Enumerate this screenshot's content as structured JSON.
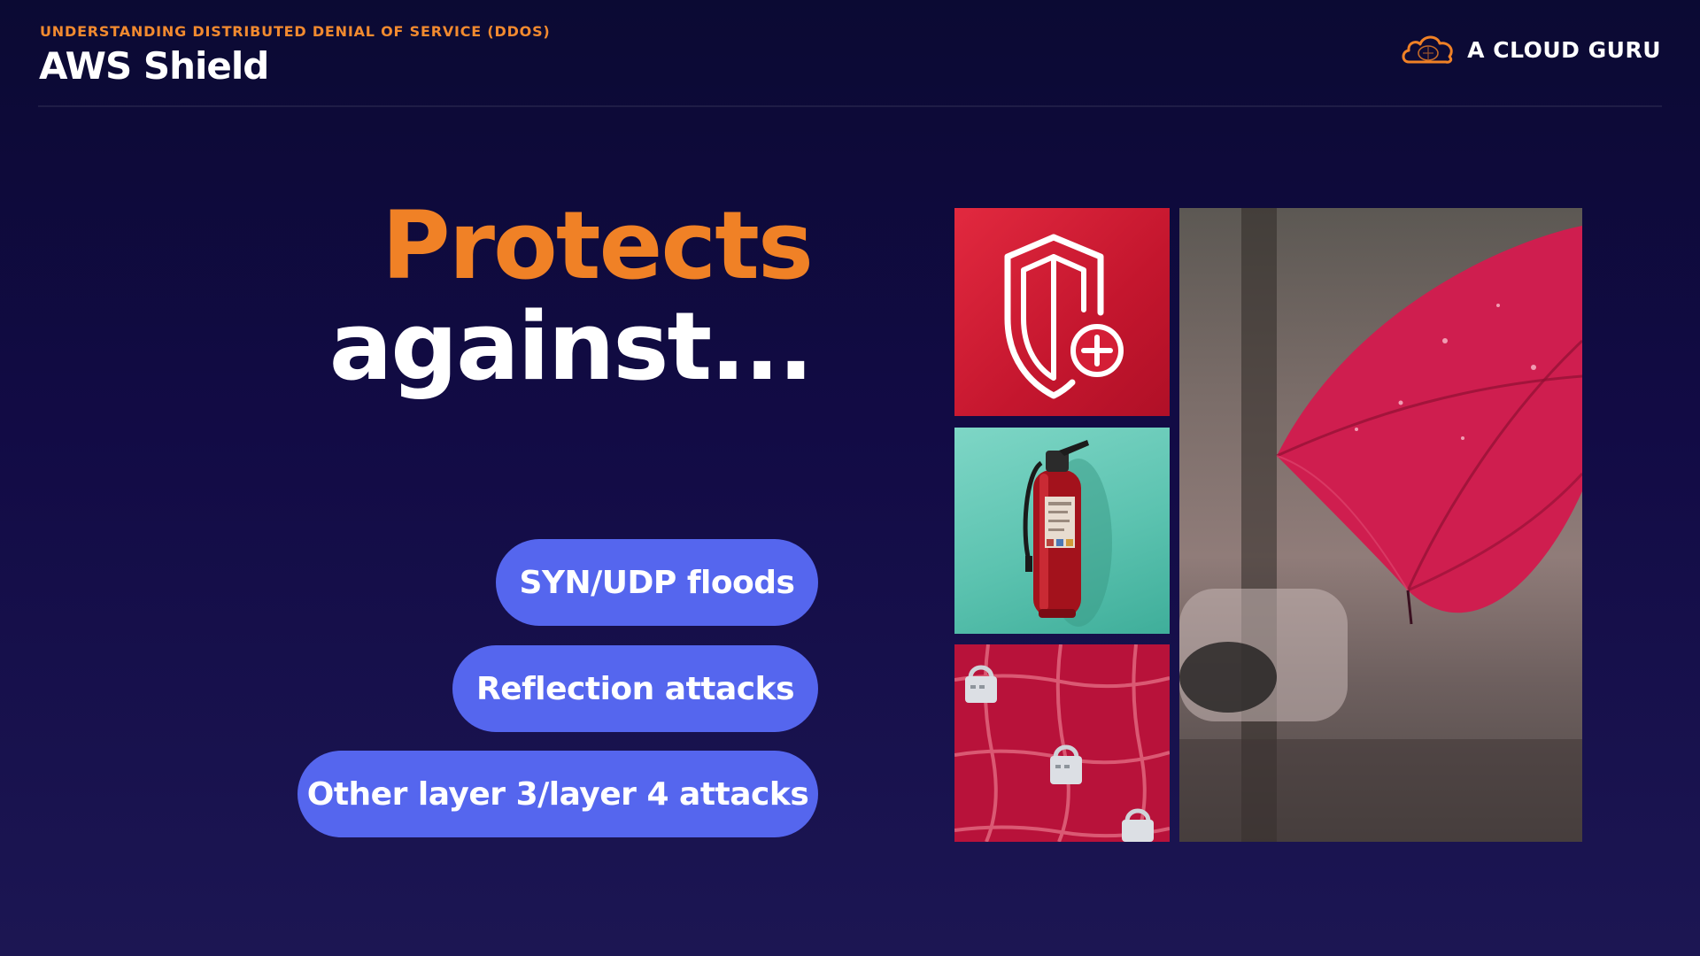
{
  "header": {
    "kicker": "UNDERSTANDING DISTRIBUTED DENIAL OF SERVICE (DDOS)",
    "title": "AWS Shield",
    "brand_name": "A CLOUD GURU",
    "brand_icon": "cloud-logo-icon"
  },
  "headline": {
    "line1": "Protects",
    "line2": "against..."
  },
  "attacks": [
    "SYN/UDP floods",
    "Reflection attacks",
    "Other layer 3/layer 4 attacks"
  ],
  "images": {
    "shield_icon": "shield-plus-icon",
    "extinguisher": "fire-extinguisher-photo",
    "locks": "padlocks-on-red-fence-photo",
    "umbrella": "red-umbrella-in-rain-photo"
  },
  "colors": {
    "background": "#120b45",
    "accent_orange": "#f08126",
    "pill_blue": "#5566ee",
    "shield_red": "#d81f38"
  }
}
